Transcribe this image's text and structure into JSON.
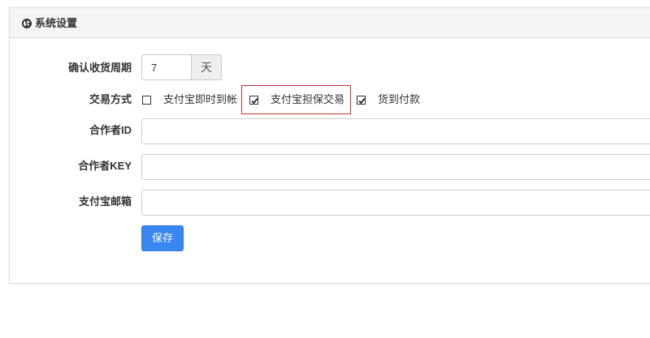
{
  "panel": {
    "title": "系统设置",
    "icon": "globe-icon"
  },
  "form": {
    "confirm_period": {
      "label": "确认收货周期",
      "value": "7",
      "unit": "天"
    },
    "trade_type": {
      "label": "交易方式",
      "options": [
        {
          "label": "支付宝即时到帐",
          "checked": false
        },
        {
          "label": "支付宝担保交易",
          "checked": true,
          "highlighted": true
        },
        {
          "label": "货到付款",
          "checked": true
        }
      ]
    },
    "partner_id": {
      "label": "合作者ID",
      "value": ""
    },
    "partner_key": {
      "label": "合作者KEY",
      "value": ""
    },
    "alipay_email": {
      "label": "支付宝邮箱",
      "value": ""
    },
    "save_label": "保存"
  },
  "colors": {
    "primary_button": "#3a87f2",
    "highlight_border": "#c9302c",
    "heading_bg": "#f5f5f5"
  }
}
